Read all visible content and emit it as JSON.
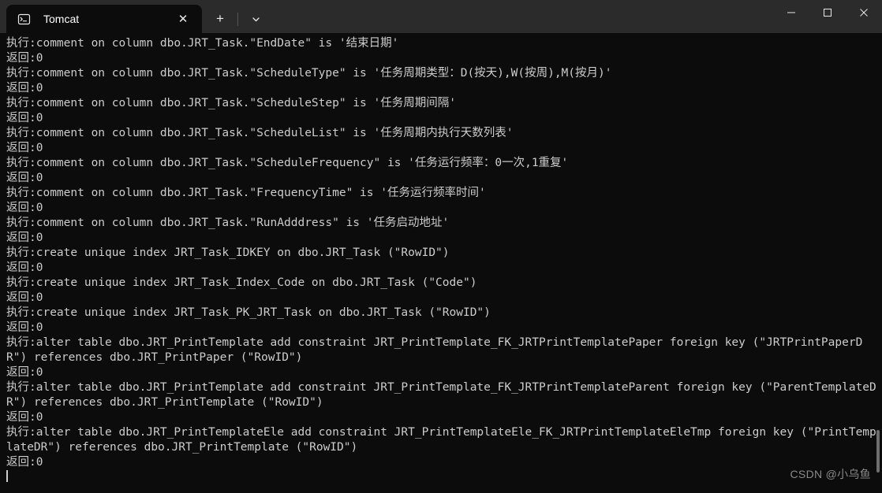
{
  "window": {
    "background_color": "#0c0c0c",
    "titlebar_color": "#2b2b2b",
    "text_color": "#cccccc"
  },
  "titlebar": {
    "tab": {
      "icon": "command-prompt-icon",
      "icon_label": "C:\\",
      "title": "Tomcat",
      "close_label": "✕"
    },
    "new_tab_label": "+",
    "dropdown_label": "⌄",
    "caption": {
      "minimize_label": "─",
      "maximize_label": "☐",
      "close_label": "✕"
    }
  },
  "terminal": {
    "lines": [
      "执行:comment on column dbo.JRT_Task.\"EndDate\" is '结束日期'",
      "返回:0",
      "执行:comment on column dbo.JRT_Task.\"ScheduleType\" is '任务周期类型：D(按天),W(按周),M(按月)'",
      "返回:0",
      "执行:comment on column dbo.JRT_Task.\"ScheduleStep\" is '任务周期间隔'",
      "返回:0",
      "执行:comment on column dbo.JRT_Task.\"ScheduleList\" is '任务周期内执行天数列表'",
      "返回:0",
      "执行:comment on column dbo.JRT_Task.\"ScheduleFrequency\" is '任务运行频率：0一次,1重复'",
      "返回:0",
      "执行:comment on column dbo.JRT_Task.\"FrequencyTime\" is '任务运行频率时间'",
      "返回:0",
      "执行:comment on column dbo.JRT_Task.\"RunAdddress\" is '任务启动地址'",
      "返回:0",
      "执行:create unique index JRT_Task_IDKEY on dbo.JRT_Task (\"RowID\")",
      "返回:0",
      "执行:create unique index JRT_Task_Index_Code on dbo.JRT_Task (\"Code\")",
      "返回:0",
      "执行:create unique index JRT_Task_PK_JRT_Task on dbo.JRT_Task (\"RowID\")",
      "返回:0",
      "执行:alter table dbo.JRT_PrintTemplate add constraint JRT_PrintTemplate_FK_JRTPrintTemplatePaper foreign key (\"JRTPrintPaperDR\") references dbo.JRT_PrintPaper (\"RowID\")",
      "返回:0",
      "执行:alter table dbo.JRT_PrintTemplate add constraint JRT_PrintTemplate_FK_JRTPrintTemplateParent foreign key (\"ParentTemplateDR\") references dbo.JRT_PrintTemplate (\"RowID\")",
      "返回:0",
      "执行:alter table dbo.JRT_PrintTemplateEle add constraint JRT_PrintTemplateEle_FK_JRTPrintTemplateEleTmp foreign key (\"PrintTemplateDR\") references dbo.JRT_PrintTemplate (\"RowID\")",
      "返回:0"
    ],
    "watermark": "CSDN @小乌鱼"
  }
}
